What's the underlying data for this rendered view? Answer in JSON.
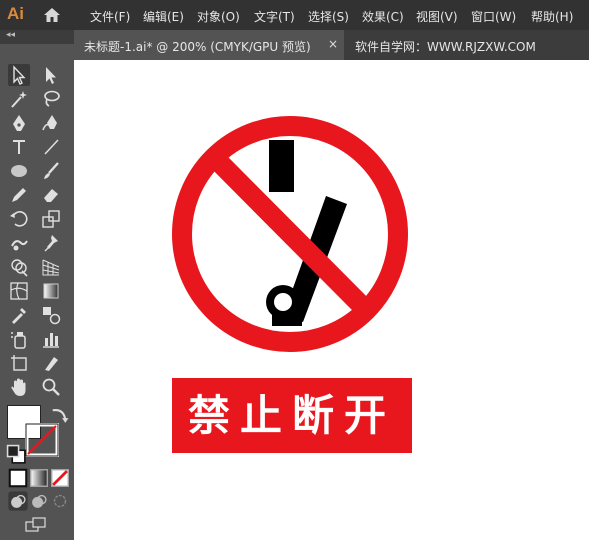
{
  "app": {
    "logo": "Ai"
  },
  "menu": [
    "文件(F)",
    "编辑(E)",
    "对象(O)",
    "文字(T)",
    "选择(S)",
    "效果(C)",
    "视图(V)",
    "窗口(W)",
    "帮助(H)"
  ],
  "document": {
    "tab_title": "未标题-1.ai* @ 200% (CMYK/GPU 预览)",
    "close": "×",
    "site_text": "软件自学网：WWW.RJZXW.COM"
  },
  "panel": {
    "collapse": "◂◂"
  },
  "artwork": {
    "sign_text": "禁止断开",
    "colors": {
      "red": "#e8171e",
      "black": "#000000",
      "white": "#ffffff"
    }
  },
  "icons": [
    "home-icon",
    "selection-tool-icon",
    "direct-selection-tool-icon",
    "magic-wand-icon",
    "lasso-icon",
    "pen-tool-icon",
    "curvature-tool-icon",
    "type-tool-icon",
    "line-tool-icon",
    "ellipse-tool-icon",
    "paintbrush-icon",
    "pencil-icon",
    "eraser-icon",
    "rotate-icon",
    "scale-icon",
    "warp-icon",
    "puppet-warp-icon",
    "shape-builder-icon",
    "perspective-grid-icon",
    "mesh-icon",
    "gradient-icon",
    "eyedropper-icon",
    "blend-icon",
    "symbol-sprayer-icon",
    "graph-icon",
    "artboard-icon",
    "slice-icon",
    "hand-icon",
    "zoom-icon"
  ]
}
